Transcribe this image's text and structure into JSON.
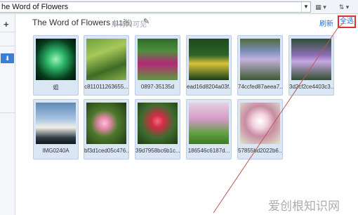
{
  "address_bar": {
    "text": "he Word of Flowers",
    "dropdown_icon": "chevron-down-icon"
  },
  "toolbar": {
    "view_label": "▦ ▾",
    "sort_label": "⇅ ▾"
  },
  "sidebar": {
    "add_symbol": "+",
    "download_symbol": "⬇"
  },
  "album": {
    "title": "The Word of Flowers",
    "count": "(11张)",
    "visibility": "所有人可见",
    "edit_icon": "pencil-icon"
  },
  "actions": {
    "refresh": "刷新",
    "select_all": "全选"
  },
  "photos": [
    {
      "caption": "姐",
      "thumb": "t-green"
    },
    {
      "caption": "c811011263655...",
      "thumb": "t-fruit"
    },
    {
      "caption": "0897-35135d",
      "thumb": "t-pinkfl"
    },
    {
      "caption": "ead16d8204a03f...",
      "thumb": "t-yellow"
    },
    {
      "caption": "74ccfed87aeea7...",
      "thumb": "t-purple"
    },
    {
      "caption": "3d2cf2ce4403c3...",
      "thumb": "t-water"
    },
    {
      "caption": "IMG0240A",
      "thumb": "t-sky"
    },
    {
      "caption": "bf3d1ced05c476...",
      "thumb": "t-lotus"
    },
    {
      "caption": "39d7958bc6b1c...",
      "thumb": "t-redlotus"
    },
    {
      "caption": "186546c6187d...",
      "thumb": "t-cherry"
    },
    {
      "caption": "57855bd2022b6...",
      "thumb": "t-blossom"
    }
  ],
  "watermark": "爱创根知识网",
  "colors": {
    "accent": "#2a6fc9",
    "highlight_box": "#e0302e",
    "tile_bg": "#dbe6f5"
  }
}
